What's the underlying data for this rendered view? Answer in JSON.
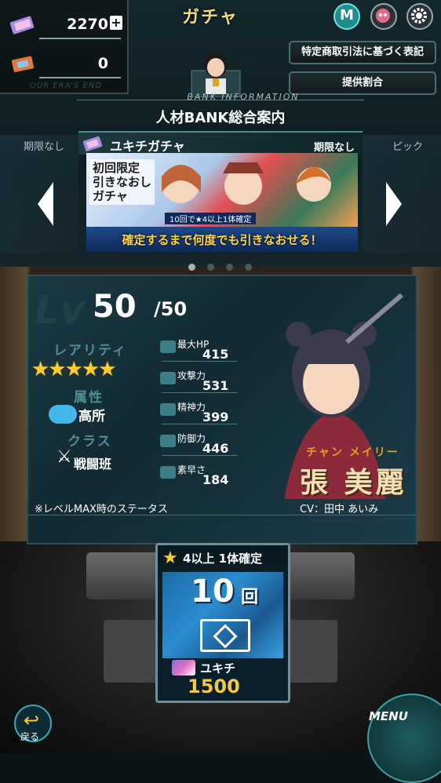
{
  "header": {
    "title": "ガチャ"
  },
  "currency": {
    "paid": {
      "value": "2270",
      "plus": "+"
    },
    "ticket": {
      "value": "0"
    },
    "footer": "OUR ERA'S END"
  },
  "top_buttons": {
    "legal_label": "特定商取引法に基づく表記",
    "rates_label": "提供割合",
    "m_label": "M"
  },
  "bank": {
    "info_label": "BANK INFORMATION",
    "title": "人材BANK総合案内"
  },
  "carousel": {
    "left_tab": "期限なし",
    "right_tab": "ピック",
    "banner": {
      "name": "ユキチガチャ",
      "limit": "期限なし",
      "art_lines": [
        "初回限定",
        "引きなおし",
        "ガチャ"
      ],
      "small_text": "10回で★4以上1体確定",
      "caption": "確定するまで何度でも引きなおせる！"
    },
    "page_count": 4,
    "active_page": 0
  },
  "status": {
    "lv_bg": "Lv",
    "level": "50",
    "level_max": "/50",
    "rarity_label": "レアリティ",
    "stars": "★★★★★",
    "attribute_label": "属性",
    "attribute_value": "高所",
    "class_label": "クラス",
    "class_value": "戦闘班",
    "stats": [
      {
        "label": "最大HP",
        "value": "415"
      },
      {
        "label": "攻撃力",
        "value": "531"
      },
      {
        "label": "精神力",
        "value": "399"
      },
      {
        "label": "防御力",
        "value": "446"
      },
      {
        "label": "素早さ",
        "value": "184"
      }
    ],
    "char_kana": "チャン メイリー",
    "char_name": "張 美麗",
    "note": "※レベルMAX時のステータス",
    "cv": "CV：田中 あいみ"
  },
  "gacha_button": {
    "header": "4以上 1体確定",
    "count": "10",
    "unit": "回",
    "currency_name": "ユキチ",
    "price": "1500"
  },
  "nav": {
    "back_label": "戻る",
    "menu_label": "MENU"
  },
  "colors": {
    "accent": "#1e8e8c",
    "gold": "#f1c84a",
    "star": "#ffcc33"
  }
}
